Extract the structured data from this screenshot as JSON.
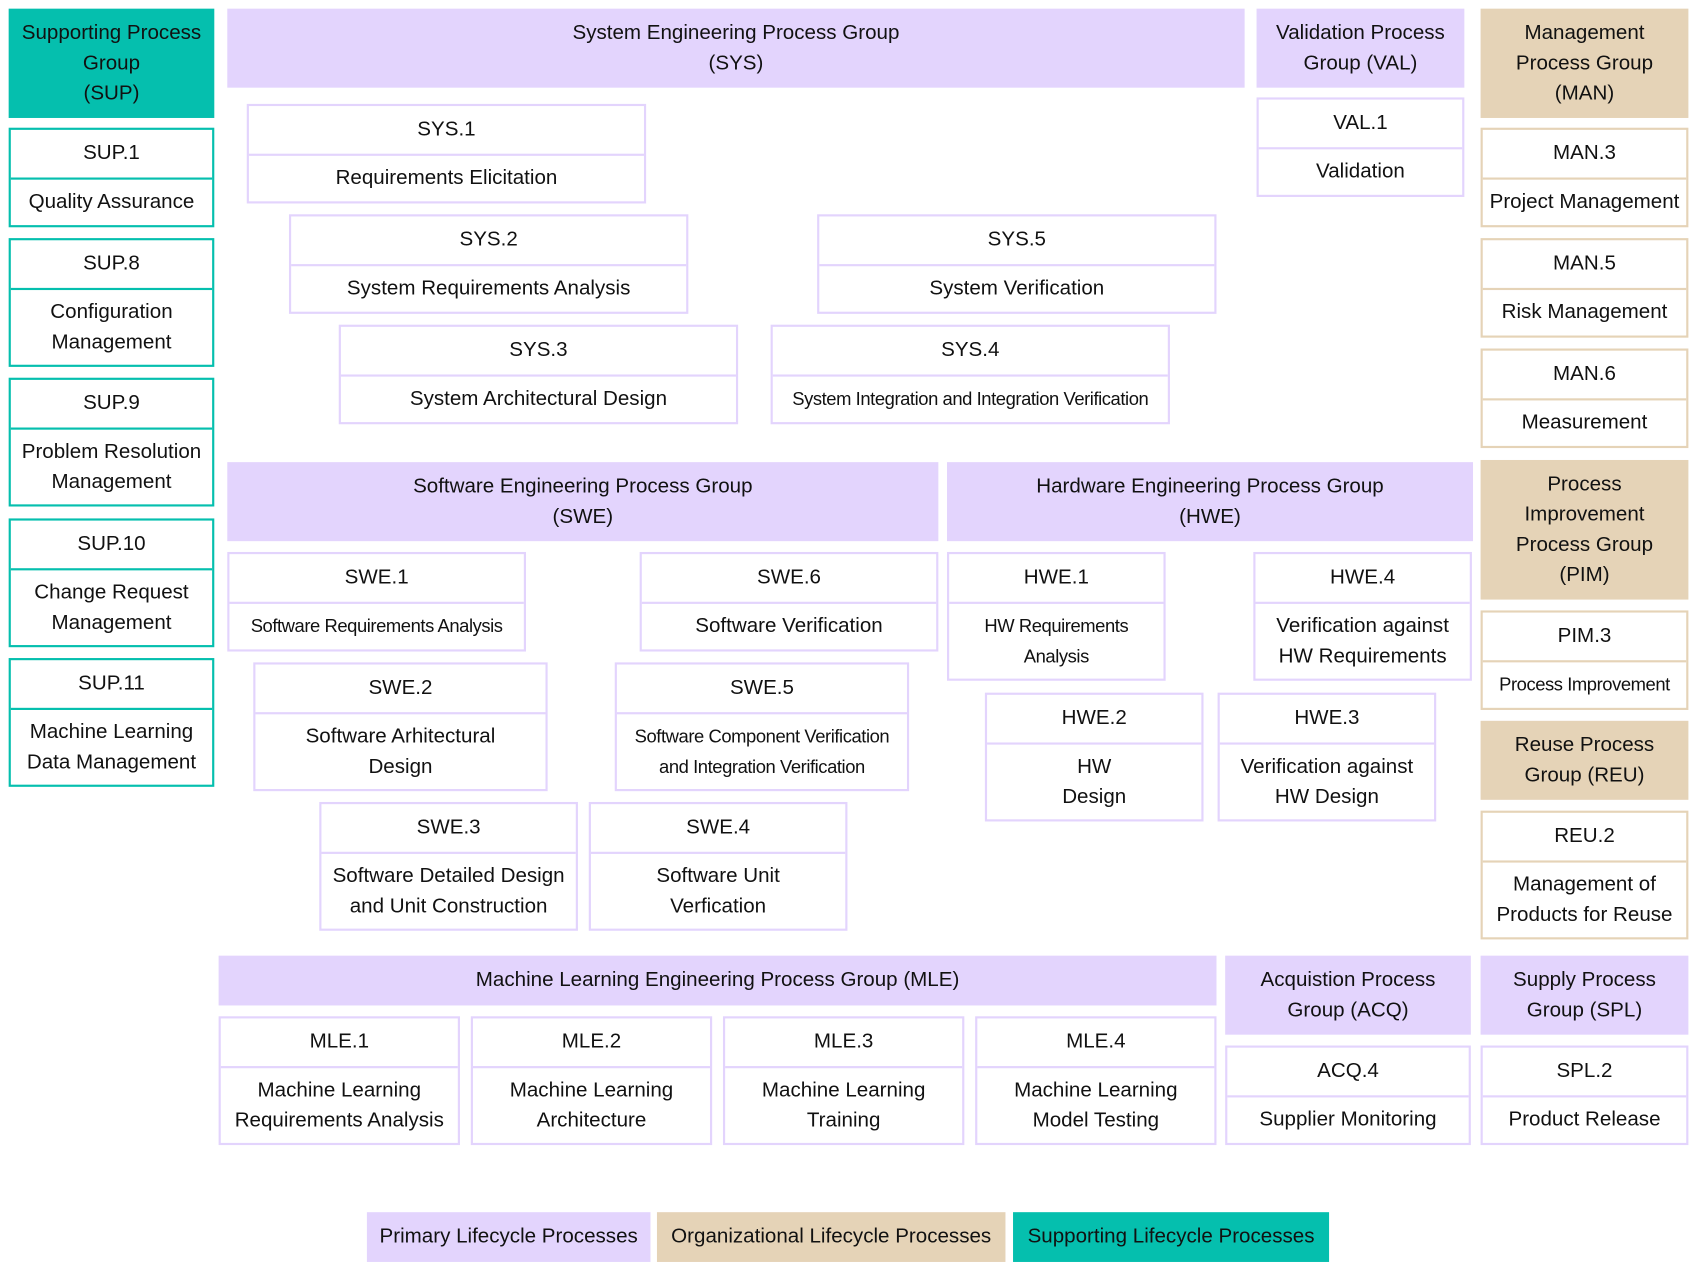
{
  "colors": {
    "primary": "#e3d4fd",
    "organizational": "#e5d3b7",
    "supporting": "#05bfae"
  },
  "groups": {
    "SUP": "Supporting Process Group\n(SUP)",
    "SYS": "System Engineering Process Group\n(SYS)",
    "VAL": "Validation Process\nGroup (VAL)",
    "MAN": "Management\nProcess Group\n(MAN)",
    "SWE": "Software Engineering Process Group\n(SWE)",
    "HWE": "Hardware Engineering Process Group\n(HWE)",
    "PIM": "Process\nImprovement\nProcess Group\n(PIM)",
    "REU": "Reuse Process\nGroup (REU)",
    "MLE": "Machine Learning Engineering Process Group (MLE)",
    "ACQ": "Acquistion Process\nGroup (ACQ)",
    "SPL": "Supply Process\nGroup (SPL)"
  },
  "processes": {
    "SUP1": {
      "id": "SUP.1",
      "name": "Quality Assurance"
    },
    "SUP8": {
      "id": "SUP.8",
      "name": "Configuration\nManagement"
    },
    "SUP9": {
      "id": "SUP.9",
      "name": "Problem Resolution\nManagement"
    },
    "SUP10": {
      "id": "SUP.10",
      "name": "Change Request\nManagement"
    },
    "SUP11": {
      "id": "SUP.11",
      "name": "Machine Learning\nData Management"
    },
    "SYS1": {
      "id": "SYS.1",
      "name": "Requirements Elicitation"
    },
    "SYS2": {
      "id": "SYS.2",
      "name": "System Requirements Analysis"
    },
    "SYS3": {
      "id": "SYS.3",
      "name": "System Architectural Design"
    },
    "SYS4": {
      "id": "SYS.4",
      "name": "System Integration and Integration Verification"
    },
    "SYS5": {
      "id": "SYS.5",
      "name": "System Verification"
    },
    "VAL1": {
      "id": "VAL.1",
      "name": "Validation"
    },
    "MAN3": {
      "id": "MAN.3",
      "name": "Project Management"
    },
    "MAN5": {
      "id": "MAN.5",
      "name": "Risk Management"
    },
    "MAN6": {
      "id": "MAN.6",
      "name": "Measurement"
    },
    "SWE1": {
      "id": "SWE.1",
      "name": "Software Requirements Analysis"
    },
    "SWE2": {
      "id": "SWE.2",
      "name": "Software Arhitectural\nDesign"
    },
    "SWE3": {
      "id": "SWE.3",
      "name": "Software Detailed Design\nand Unit Construction"
    },
    "SWE4": {
      "id": "SWE.4",
      "name": "Software Unit\nVerfication"
    },
    "SWE5": {
      "id": "SWE.5",
      "name": "Software Component Verification\nand Integration Verification"
    },
    "SWE6": {
      "id": "SWE.6",
      "name": "Software Verification"
    },
    "HWE1": {
      "id": "HWE.1",
      "name": "HW Requirements\nAnalysis"
    },
    "HWE2": {
      "id": "HWE.2",
      "name": "HW\nDesign"
    },
    "HWE3": {
      "id": "HWE.3",
      "name": "Verification against\nHW Design"
    },
    "HWE4": {
      "id": "HWE.4",
      "name": "Verification against\nHW Requirements"
    },
    "PIM3": {
      "id": "PIM.3",
      "name": "Process Improvement"
    },
    "REU2": {
      "id": "REU.2",
      "name": "Management of\nProducts for Reuse"
    },
    "MLE1": {
      "id": "MLE.1",
      "name": "Machine Learning\nRequirements Analysis"
    },
    "MLE2": {
      "id": "MLE.2",
      "name": "Machine Learning\nArchitecture"
    },
    "MLE3": {
      "id": "MLE.3",
      "name": "Machine Learning\nTraining"
    },
    "MLE4": {
      "id": "MLE.4",
      "name": "Machine Learning\nModel Testing"
    },
    "ACQ4": {
      "id": "ACQ.4",
      "name": "Supplier Monitoring"
    },
    "SPL2": {
      "id": "SPL.2",
      "name": "Product Release"
    }
  },
  "legend": {
    "primary": "Primary Lifecycle Processes",
    "organizational": "Organizational Lifecycle Processes",
    "supporting": "Supporting Lifecycle Processes"
  }
}
